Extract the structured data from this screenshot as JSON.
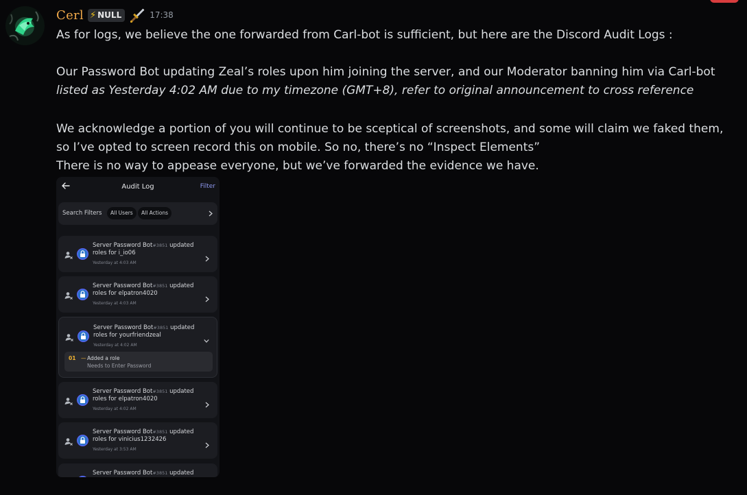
{
  "author": {
    "username": "Cerl",
    "tag_icon": "lightning-bolt-icon",
    "tag_label": "NULL",
    "badge_icon": "sword-icon",
    "timestamp": "17:38",
    "name_color": "#f0a94a"
  },
  "message": {
    "line1": "As for logs, we believe the one forwarded from Carl-bot is sufficient, but here are the Discord Audit Logs :",
    "line2": "Our Password Bot updating Zeal’s roles upon him joining the server, and our Moderator banning him via Carl-bot",
    "line3": "listed as Yesterday 4:02 AM due to my timezone (GMT+8), refer to original announcement to cross reference",
    "line4": "We acknowledge a portion of you will continue to be sceptical of screenshots, and some will claim we faked them,",
    "line5": "so I’ve opted to screen record this on mobile. So no, there’s no “Inspect Elements”",
    "line6": "There is no way to appease everyone, but we’ve forwarded the evidence we have."
  },
  "screenshot": {
    "title": "Audit Log",
    "filter_label": "Filter",
    "search_filters_label": "Search Filters",
    "all_users_label": "All Users",
    "all_actions_label": "All Actions",
    "accent_color": "#8e98f0",
    "entries": [
      {
        "actor": "Server Password Bot",
        "discriminator": "#3851",
        "action": "updated",
        "line2": "roles for i_io06",
        "time": "Yesterday at 4:03 AM"
      },
      {
        "actor": "Server Password Bot",
        "discriminator": "#3851",
        "action": "updated",
        "line2": "roles for elpatron4020",
        "time": "Yesterday at 4:03 AM"
      },
      {
        "actor": "Server Password Bot",
        "discriminator": "#3851",
        "action": "updated",
        "line2": "roles for yourfriendzeal",
        "time": "Yesterday at 4:02 AM",
        "change": {
          "number": "01",
          "dash": "—",
          "title": "Added a role",
          "detail": "Needs to Enter Password"
        }
      },
      {
        "actor": "Server Password Bot",
        "discriminator": "#3851",
        "action": "updated",
        "line2": "roles for elpatron4020",
        "time": "Yesterday at 4:02 AM"
      },
      {
        "actor": "Server Password Bot",
        "discriminator": "#3851",
        "action": "updated",
        "line2": "roles for vinicius1232426",
        "time": "Yesterday at 3:53 AM"
      },
      {
        "actor": "Server Password Bot",
        "discriminator": "#3851",
        "action": "updated",
        "line2": "",
        "time": ""
      }
    ]
  }
}
